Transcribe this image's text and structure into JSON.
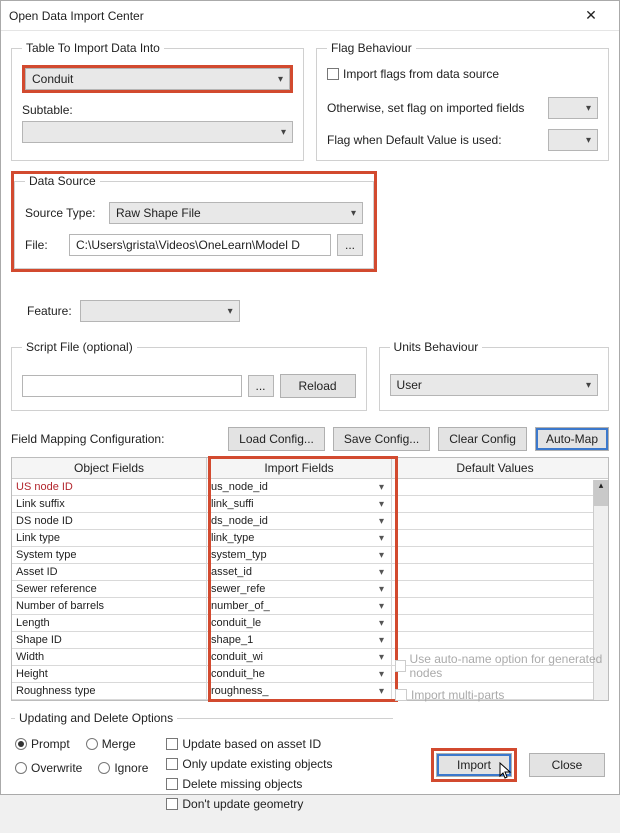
{
  "window": {
    "title": "Open Data Import Center"
  },
  "table_to_import": {
    "legend": "Table To Import Data Into",
    "table_select": "Conduit",
    "subtable_label": "Subtable:",
    "subtable_value": ""
  },
  "flag": {
    "legend": "Flag Behaviour",
    "import_flags": "Import flags from data source",
    "otherwise": "Otherwise, set flag on imported fields",
    "when_default": "Flag when Default Value is used:"
  },
  "datasource": {
    "legend": "Data Source",
    "source_type_label": "Source Type:",
    "source_type_value": "Raw Shape File",
    "feature_label": "Feature:",
    "file_label": "File:",
    "file_value": "C:\\Users\\grista\\Videos\\OneLearn\\Model D"
  },
  "script": {
    "legend": "Script File (optional)",
    "reload": "Reload"
  },
  "units": {
    "legend": "Units Behaviour",
    "value": "User"
  },
  "mapping": {
    "label": "Field Mapping Configuration:",
    "load": "Load Config...",
    "save": "Save Config...",
    "clear": "Clear Config",
    "auto": "Auto-Map"
  },
  "table": {
    "headers": {
      "obj": "Object Fields",
      "imp": "Import Fields",
      "def": "Default Values"
    },
    "rows": [
      {
        "obj": "US node ID",
        "imp": "us_node_id",
        "first": true
      },
      {
        "obj": "Link suffix",
        "imp": "link_suffi"
      },
      {
        "obj": "DS node ID",
        "imp": "ds_node_id"
      },
      {
        "obj": "Link type",
        "imp": "link_type"
      },
      {
        "obj": "System type",
        "imp": "system_typ"
      },
      {
        "obj": "Asset ID",
        "imp": "asset_id"
      },
      {
        "obj": "Sewer reference",
        "imp": "sewer_refe"
      },
      {
        "obj": "Number of barrels",
        "imp": "number_of_"
      },
      {
        "obj": "Length",
        "imp": "conduit_le"
      },
      {
        "obj": "Shape ID",
        "imp": "shape_1"
      },
      {
        "obj": "Width",
        "imp": "conduit_wi"
      },
      {
        "obj": "Height",
        "imp": "conduit_he"
      },
      {
        "obj": "Roughness type",
        "imp": "roughness_"
      }
    ]
  },
  "update": {
    "legend": "Updating and Delete Options",
    "prompt": "Prompt",
    "merge": "Merge",
    "overwrite": "Overwrite",
    "ignore": "Ignore",
    "based_on_asset": "Update based on asset ID",
    "only_existing": "Only update existing objects",
    "delete_missing": "Delete missing objects",
    "no_geom": "Don't update geometry"
  },
  "rightopts": {
    "autoname": "Use auto-name option for generated nodes",
    "multipart": "Import multi-parts"
  },
  "footer": {
    "import": "Import",
    "close": "Close"
  }
}
